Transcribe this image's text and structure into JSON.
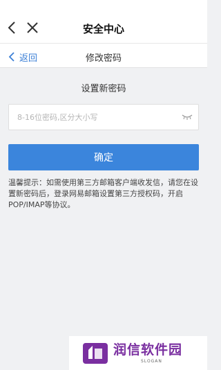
{
  "header": {
    "title": "安全中心",
    "back_icon": "chevron-left-icon",
    "close_icon": "close-icon"
  },
  "subheader": {
    "back_label": "返回",
    "title": "修改密码"
  },
  "form": {
    "section_title": "设置新密码",
    "password_placeholder": "8-16位密码,区分大小写",
    "password_value": "",
    "visibility_icon": "eye-closed-icon",
    "confirm_label": "确定"
  },
  "tip": "温馨提示：如需使用第三方邮箱客户端收发信，请您在设置新密码后，登录网易邮箱设置第三方授权码，开启POP/IMAP等协议。",
  "watermark": {
    "brand": "润信软件园",
    "slogan": "SLOGAN"
  },
  "colors": {
    "accent": "#3b85dc",
    "link": "#3b7fd6",
    "background": "#f0f1f3",
    "brand": "#7a2fa0"
  }
}
